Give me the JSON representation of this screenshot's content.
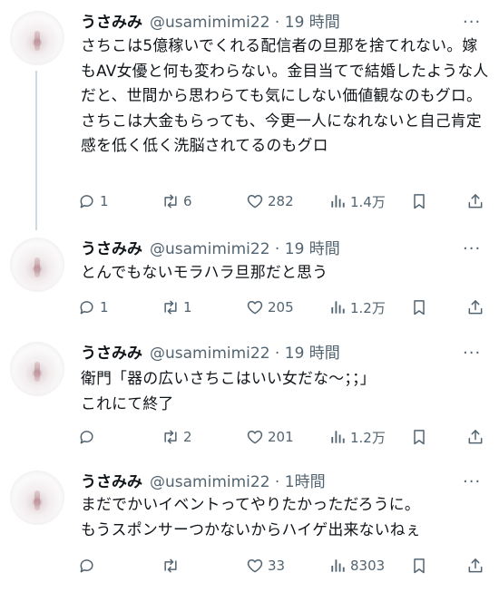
{
  "tweets": [
    {
      "display_name": "うさみみ",
      "handle": "@usamimimi22",
      "time": "19 時間",
      "text": "さちこは5億稼いでくれる配信者の旦那を捨てれない。嫁もAV女優と何も変わらない。金目当てで結婚したような人だと、世間から思わらても気にしない価値観なのもグロ。さちこは大金もらっても、今更一人になれないと自己肯定感を低く低く洗脳されてるのもグロ",
      "replies": "1",
      "retweets": "6",
      "likes": "282",
      "views": "1.4万"
    },
    {
      "display_name": "うさみみ",
      "handle": "@usamimimi22",
      "time": "19 時間",
      "text": "とんでもないモラハラ旦那だと思う",
      "replies": "1",
      "retweets": "1",
      "likes": "205",
      "views": "1.2万"
    },
    {
      "display_name": "うさみみ",
      "handle": "@usamimimi22",
      "time": "19 時間",
      "text": "衛門「器の広いさちこはいい女だな〜；；」\nこれにて終了",
      "replies": "",
      "retweets": "2",
      "likes": "201",
      "views": "1.2万"
    },
    {
      "display_name": "うさみみ",
      "handle": "@usamimimi22",
      "time": "1時間",
      "text": "まだでかいイベントってやりたかっただろうに。\nもうスポンサーつかないからハイゲ出来ないねぇ",
      "replies": "",
      "retweets": "",
      "likes": "33",
      "views": "8303"
    }
  ],
  "icons": {
    "more": "more-options-icon",
    "reply": "reply-icon",
    "retweet": "retweet-icon",
    "like": "like-icon",
    "views": "views-icon",
    "bookmark": "bookmark-icon",
    "share": "share-icon"
  },
  "colors": {
    "text": "#0f1419",
    "secondary": "#536471",
    "thread_line": "#cfd9de"
  }
}
